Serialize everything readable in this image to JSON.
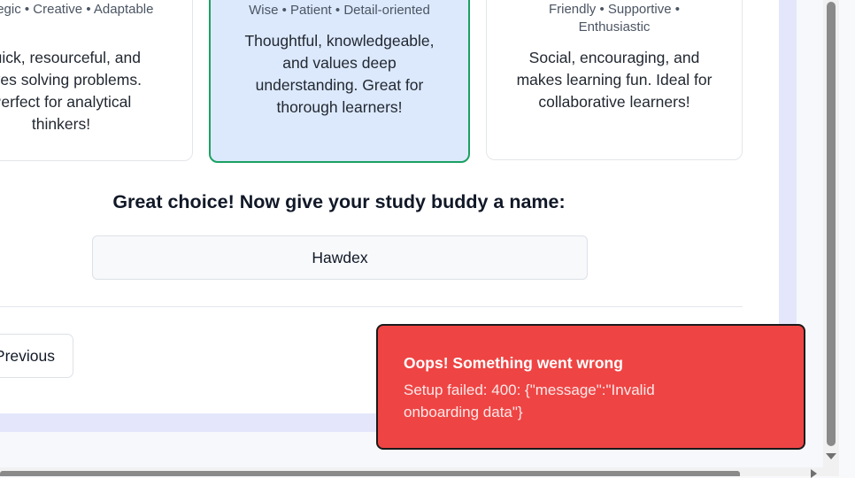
{
  "cards": {
    "left": {
      "traits": "Strategic • Creative • Adaptable",
      "description": "Quick, resourceful, and loves solving problems. Perfect for analytical thinkers!"
    },
    "middle": {
      "traits": "Wise • Patient • Detail-oriented",
      "description": "Thoughtful, knowledgeable, and values deep understanding. Great for thorough learners!",
      "selected": true
    },
    "right": {
      "traits": "Friendly • Supportive • Enthusiastic",
      "description": "Social, encouraging, and makes learning fun. Ideal for collaborative learners!"
    }
  },
  "naming": {
    "prompt": "Great choice! Now give your study buddy a name:",
    "value": "Hawdex"
  },
  "navigation": {
    "previous_label": "Previous"
  },
  "toast": {
    "title": "Oops! Something went wrong",
    "message": "Setup failed: 400: {\"message\":\"Invalid onboarding data\"}",
    "color": "#ef4444"
  },
  "colors": {
    "selected_card_bg": "#dce9fd",
    "selected_card_border": "#1ba162"
  }
}
